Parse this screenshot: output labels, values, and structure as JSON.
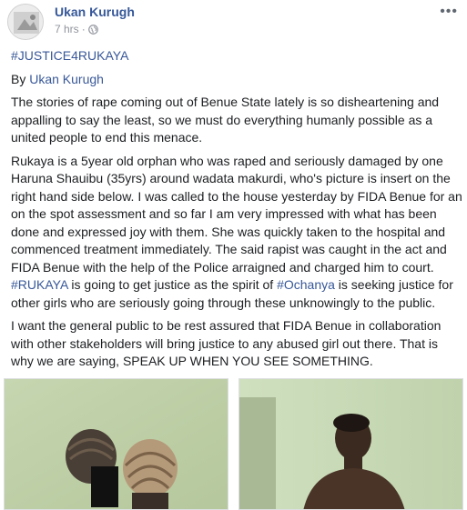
{
  "post": {
    "author": "Ukan Kurugh",
    "time": "7 hrs",
    "separator": "·",
    "more": "•••",
    "hashtag_title": "#JUSTICE4RUKAYA",
    "byline_prefix": "By ",
    "byline_name": "Ukan Kurugh",
    "para1": "The stories of rape coming out of Benue State lately is so disheartening and appalling to say the least, so we must do everything humanly possible as a united people to end this menace.",
    "para2_main": "Rukaya is a 5year old orphan who was raped and seriously damaged by one Haruna Shauibu (35yrs) around wadata makurdi, who's picture is insert on the right hand side below. I was called to the house yesterday by FIDA Benue for an on the spot assessment and so far I am very impressed with what has been done and expressed joy with them. She was quickly taken to the hospital and commenced treatment immediately. The said rapist was caught in the act and FIDA Benue with the help of the Police arraigned and charged him to court.",
    "para2_tag1": "#RUKAYA",
    "para2_mid": " is going to get justice as the spirit of ",
    "para2_tag2": "#Ochanya",
    "para2_end": " is seeking justice for other girls who are seriously going through these unknowingly to the public.",
    "para3": "I want the general public to be rest assured that FIDA Benue in collaboration with other stakeholders will bring justice to any abused girl out there. That is why we are saying, SPEAK UP WHEN YOU SEE SOMETHING."
  },
  "colors": {
    "link": "#385898",
    "author": "#365899",
    "meta": "#90949c",
    "wall": "#c9d8b4"
  },
  "icons": {
    "privacy": "globe-icon",
    "options": "more-options-icon"
  }
}
